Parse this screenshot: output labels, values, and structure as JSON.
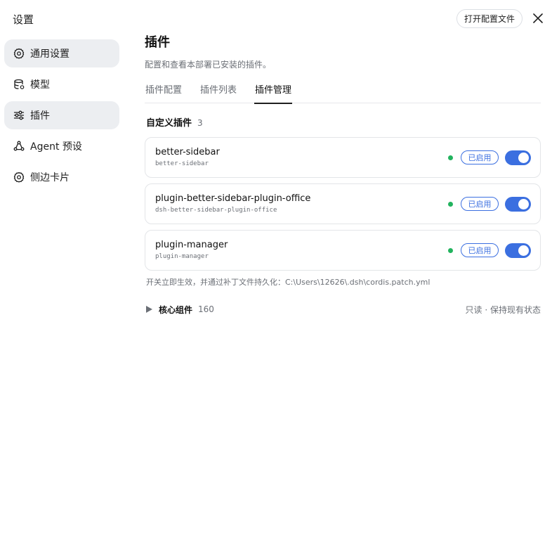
{
  "header": {
    "title": "设置",
    "open_config_label": "打开配置文件",
    "close_icon": "close-icon"
  },
  "sidebar": {
    "items": [
      {
        "label": "通用设置",
        "icon": "gear-icon",
        "active": true
      },
      {
        "label": "模型",
        "icon": "database-icon",
        "active": false
      },
      {
        "label": "插件",
        "icon": "sliders-icon",
        "active": true
      },
      {
        "label": "Agent 预设",
        "icon": "agent-icon",
        "active": false
      },
      {
        "label": "侧边卡片",
        "icon": "gear-icon",
        "active": false
      }
    ]
  },
  "main": {
    "title": "插件",
    "description": "配置和查看本部署已安装的插件。",
    "tabs": [
      {
        "label": "插件配置",
        "active": false
      },
      {
        "label": "插件列表",
        "active": false
      },
      {
        "label": "插件管理",
        "active": true
      }
    ],
    "custom_section": {
      "title": "自定义插件",
      "count": "3"
    },
    "plugins": [
      {
        "name": "better-sidebar",
        "id": "better-sidebar",
        "status": "已启用",
        "enabled": true
      },
      {
        "name": "plugin-better-sidebar-plugin-office",
        "id": "dsh-better-sidebar-plugin-office",
        "status": "已启用",
        "enabled": true
      },
      {
        "name": "plugin-manager",
        "id": "plugin-manager",
        "status": "已启用",
        "enabled": true
      }
    ],
    "note": "开关立即生效，并通过补丁文件持久化：C:\\Users\\12626\\.dsh\\cordis.patch.yml",
    "core_section": {
      "title": "核心组件",
      "count": "160",
      "status": "只读 · 保持现有状态"
    }
  },
  "colors": {
    "accent": "#3b6fe0",
    "status_green": "#22b35e",
    "active_nav_bg": "#eceef1"
  }
}
